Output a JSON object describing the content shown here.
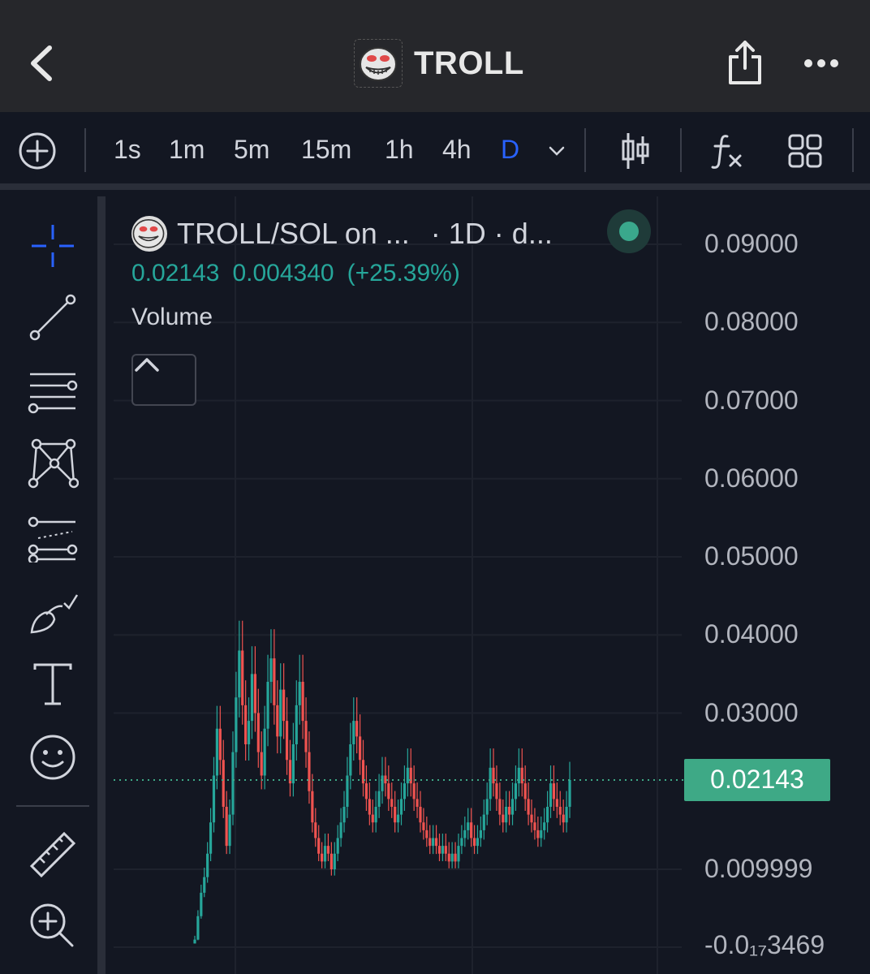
{
  "app": {
    "title": "TROLL"
  },
  "toolbar": {
    "timeframes": [
      "1s",
      "1m",
      "5m",
      "15m",
      "1h",
      "4h",
      "D"
    ],
    "active_timeframe": "D"
  },
  "legend": {
    "pair": "TROLL/SOL on ...",
    "interval": "· 1D · d...",
    "last_value": "0.02143",
    "change": "0.004340",
    "change_pct": "(+25.39%)",
    "volume_label": "Volume"
  },
  "colors": {
    "up": "#26a69a",
    "down": "#ef5350",
    "active": "#2962ff",
    "last_price_bg": "#3ea986"
  },
  "icons": {
    "sidebar": [
      "crosshair-icon",
      "trend-line-icon",
      "fib-lines-icon",
      "pattern-icon",
      "projection-icon",
      "brush-icon",
      "text-icon",
      "emoji-icon",
      "ruler-icon",
      "zoom-in-icon"
    ]
  },
  "chart_data": {
    "type": "candlestick",
    "y_ticks": [
      "0.09000",
      "0.08000",
      "0.07000",
      "0.06000",
      "0.05000",
      "0.04000",
      "0.03000",
      "0.009999"
    ],
    "y_tick_values": [
      0.09,
      0.08,
      0.07,
      0.06,
      0.05,
      0.04,
      0.03,
      0.01
    ],
    "bottom_tick": "-0.0₁₇3469",
    "last_price": "0.02143",
    "last_price_value": 0.02143,
    "ylim": [
      0.0,
      0.09
    ],
    "closes": [
      0.001,
      0.004,
      0.007,
      0.009,
      0.012,
      0.016,
      0.022,
      0.028,
      0.024,
      0.018,
      0.013,
      0.017,
      0.025,
      0.032,
      0.038,
      0.031,
      0.026,
      0.029,
      0.035,
      0.03,
      0.025,
      0.022,
      0.028,
      0.034,
      0.037,
      0.031,
      0.027,
      0.033,
      0.029,
      0.024,
      0.021,
      0.026,
      0.031,
      0.034,
      0.029,
      0.025,
      0.02,
      0.016,
      0.014,
      0.012,
      0.011,
      0.013,
      0.012,
      0.01,
      0.012,
      0.014,
      0.016,
      0.018,
      0.022,
      0.026,
      0.029,
      0.027,
      0.024,
      0.021,
      0.019,
      0.017,
      0.016,
      0.018,
      0.02,
      0.022,
      0.021,
      0.019,
      0.018,
      0.016,
      0.017,
      0.019,
      0.021,
      0.023,
      0.021,
      0.019,
      0.018,
      0.016,
      0.015,
      0.014,
      0.013,
      0.014,
      0.013,
      0.012,
      0.013,
      0.012,
      0.011,
      0.012,
      0.011,
      0.013,
      0.014,
      0.015,
      0.016,
      0.014,
      0.013,
      0.014,
      0.015,
      0.017,
      0.019,
      0.023,
      0.021,
      0.019,
      0.017,
      0.016,
      0.018,
      0.017,
      0.019,
      0.021,
      0.023,
      0.021,
      0.019,
      0.017,
      0.016,
      0.015,
      0.014,
      0.015,
      0.016,
      0.018,
      0.021,
      0.019,
      0.018,
      0.017,
      0.016,
      0.018,
      0.02143
    ]
  }
}
